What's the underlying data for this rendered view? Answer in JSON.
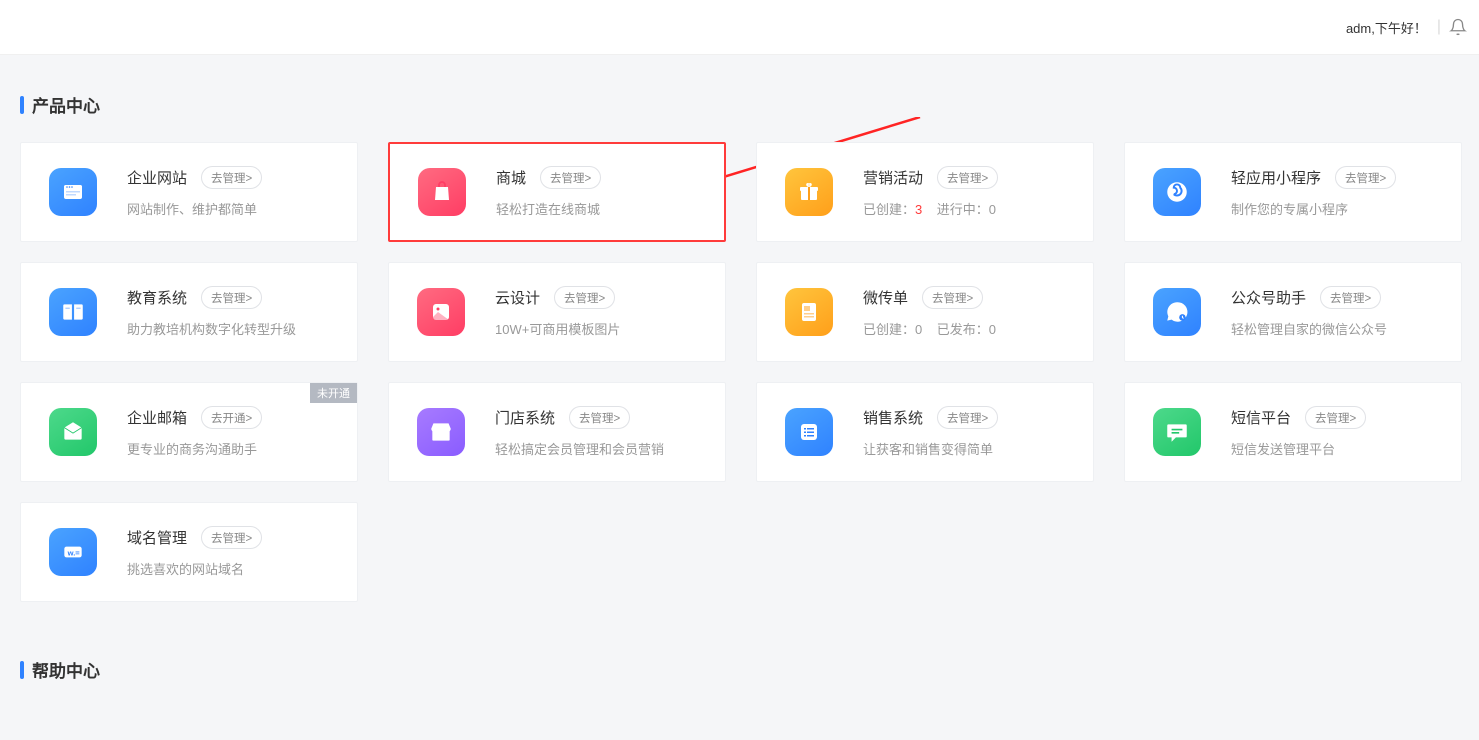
{
  "header": {
    "greeting": "adm,下午好！"
  },
  "sections": {
    "products_title": "产品中心",
    "help_title": "帮助中心"
  },
  "badge_not_open": "未开通",
  "cards": [
    {
      "title": "企业网站",
      "btn": "去管理>",
      "desc": "网站制作、维护都简单"
    },
    {
      "title": "商城",
      "btn": "去管理>",
      "desc": "轻松打造在线商城"
    },
    {
      "title": "营销活动",
      "btn": "去管理>",
      "stat1_label": "已创建：",
      "stat1_val": "3",
      "stat2_label": "进行中：",
      "stat2_val": "0"
    },
    {
      "title": "轻应用小程序",
      "btn": "去管理>",
      "desc": "制作您的专属小程序"
    },
    {
      "title": "教育系统",
      "btn": "去管理>",
      "desc": "助力教培机构数字化转型升级"
    },
    {
      "title": "云设计",
      "btn": "去管理>",
      "desc": "10W+可商用模板图片"
    },
    {
      "title": "微传单",
      "btn": "去管理>",
      "stat1_label": "已创建：",
      "stat1_val": "0",
      "stat2_label": "已发布：",
      "stat2_val": "0"
    },
    {
      "title": "公众号助手",
      "btn": "去管理>",
      "desc": "轻松管理自家的微信公众号"
    },
    {
      "title": "企业邮箱",
      "btn": "去开通>",
      "desc": "更专业的商务沟通助手"
    },
    {
      "title": "门店系统",
      "btn": "去管理>",
      "desc": "轻松搞定会员管理和会员营销"
    },
    {
      "title": "销售系统",
      "btn": "去管理>",
      "desc": "让获客和销售变得简单"
    },
    {
      "title": "短信平台",
      "btn": "去管理>",
      "desc": "短信发送管理平台"
    },
    {
      "title": "域名管理",
      "btn": "去管理>",
      "desc": "挑选喜欢的网站域名"
    }
  ]
}
